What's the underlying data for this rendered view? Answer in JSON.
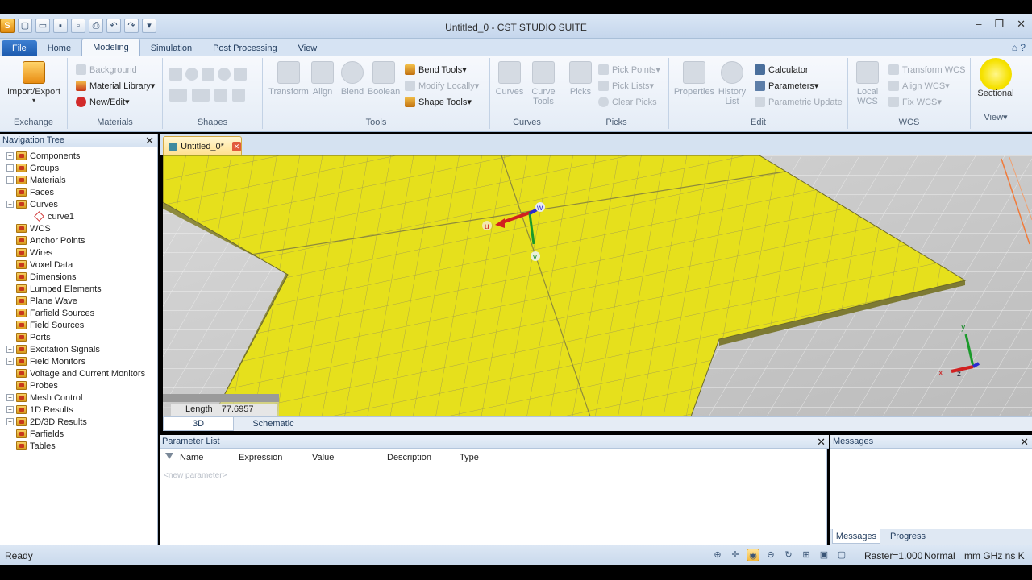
{
  "window": {
    "title": "Untitled_0 - CST STUDIO SUITE",
    "controls": [
      "–",
      "❐",
      "✕"
    ]
  },
  "quick_access": [
    "✎",
    "▢",
    "📂",
    "💾",
    "↶",
    "↷",
    "▾"
  ],
  "tabs": [
    {
      "label": "File"
    },
    {
      "label": "Home"
    },
    {
      "label": "Modeling"
    },
    {
      "label": "Simulation"
    },
    {
      "label": "Post Processing"
    },
    {
      "label": "View"
    }
  ],
  "ribbon": {
    "exchange": {
      "import_export": "Import/Export",
      "label": "Exchange"
    },
    "materials": {
      "background": "Background",
      "material_library": "Material Library▾",
      "new_edit": "New/Edit▾",
      "label": "Materials"
    },
    "shapes": {
      "label": "Shapes"
    },
    "tools": {
      "transform": "Transform",
      "align": "Align",
      "blend": "Blend",
      "boolean": "Boolean",
      "bend_tools": "Bend Tools▾",
      "modify_locally": "Modify Locally▾",
      "shape_tools": "Shape Tools▾",
      "label": "Tools"
    },
    "curves": {
      "curves": "Curves",
      "curve_tools": "Curve Tools",
      "label": "Curves"
    },
    "picks": {
      "picks": "Picks",
      "pick_points": "Pick Points▾",
      "pick_lists": "Pick Lists▾",
      "clear_picks": "Clear Picks",
      "label": "Picks"
    },
    "edit": {
      "properties": "Properties",
      "history_list": "History List",
      "calculator": "Calculator",
      "parameters": "Parameters▾",
      "parametric_update": "Parametric Update",
      "label": "Edit"
    },
    "wcs": {
      "local_wcs": "Local WCS",
      "transform_wcs": "Transform WCS",
      "align_wcs": "Align WCS▾",
      "fix_wcs": "Fix WCS▾",
      "label": "WCS"
    },
    "view": {
      "sectional": "Sectional",
      "label": "View▾"
    }
  },
  "navigation": {
    "title": "Navigation Tree",
    "items": [
      {
        "label": "Components",
        "expandable": true
      },
      {
        "label": "Groups",
        "expandable": true
      },
      {
        "label": "Materials",
        "expandable": true
      },
      {
        "label": "Faces",
        "expandable": false
      },
      {
        "label": "Curves",
        "expandable": true,
        "expanded": true
      },
      {
        "label": "curve1",
        "child": true
      },
      {
        "label": "WCS",
        "expandable": false
      },
      {
        "label": "Anchor Points",
        "expandable": false
      },
      {
        "label": "Wires",
        "expandable": false
      },
      {
        "label": "Voxel Data",
        "expandable": false
      },
      {
        "label": "Dimensions",
        "expandable": false
      },
      {
        "label": "Lumped Elements",
        "expandable": false
      },
      {
        "label": "Plane Wave",
        "expandable": false
      },
      {
        "label": "Farfield Sources",
        "expandable": false
      },
      {
        "label": "Field Sources",
        "expandable": false
      },
      {
        "label": "Ports",
        "expandable": false
      },
      {
        "label": "Excitation Signals",
        "expandable": true
      },
      {
        "label": "Field Monitors",
        "expandable": true
      },
      {
        "label": "Voltage and Current Monitors",
        "expandable": false
      },
      {
        "label": "Probes",
        "expandable": false
      },
      {
        "label": "Mesh Control",
        "expandable": true
      },
      {
        "label": "1D Results",
        "expandable": true
      },
      {
        "label": "2D/3D Results",
        "expandable": true
      },
      {
        "label": "Farfields",
        "expandable": false
      },
      {
        "label": "Tables",
        "expandable": false
      }
    ]
  },
  "document_tab": {
    "label": "Untitled_0*"
  },
  "viewport": {
    "length_label": "Length",
    "length_value": "77.6957",
    "axis_labels": {
      "u": "u",
      "v": "v",
      "w": "w",
      "x": "x",
      "y": "y",
      "z": "z"
    },
    "view_tabs": [
      "3D",
      "Schematic"
    ]
  },
  "parameter_list": {
    "title": "Parameter List",
    "columns": [
      "Name",
      "Expression",
      "Value",
      "Description",
      "Type"
    ],
    "new_row_placeholder": "<new parameter>"
  },
  "messages": {
    "title": "Messages",
    "tabs": [
      "Messages",
      "Progress"
    ]
  },
  "statusbar": {
    "status": "Ready",
    "raster": "Raster=1.000",
    "mode": "Normal",
    "units": "mm  GHz  ns  K"
  },
  "colors": {
    "plate": "#e6e01c",
    "grid_line": "#9a9a3a",
    "background_floor": "#cfcfcf",
    "accent_file": "#1c5aae"
  }
}
